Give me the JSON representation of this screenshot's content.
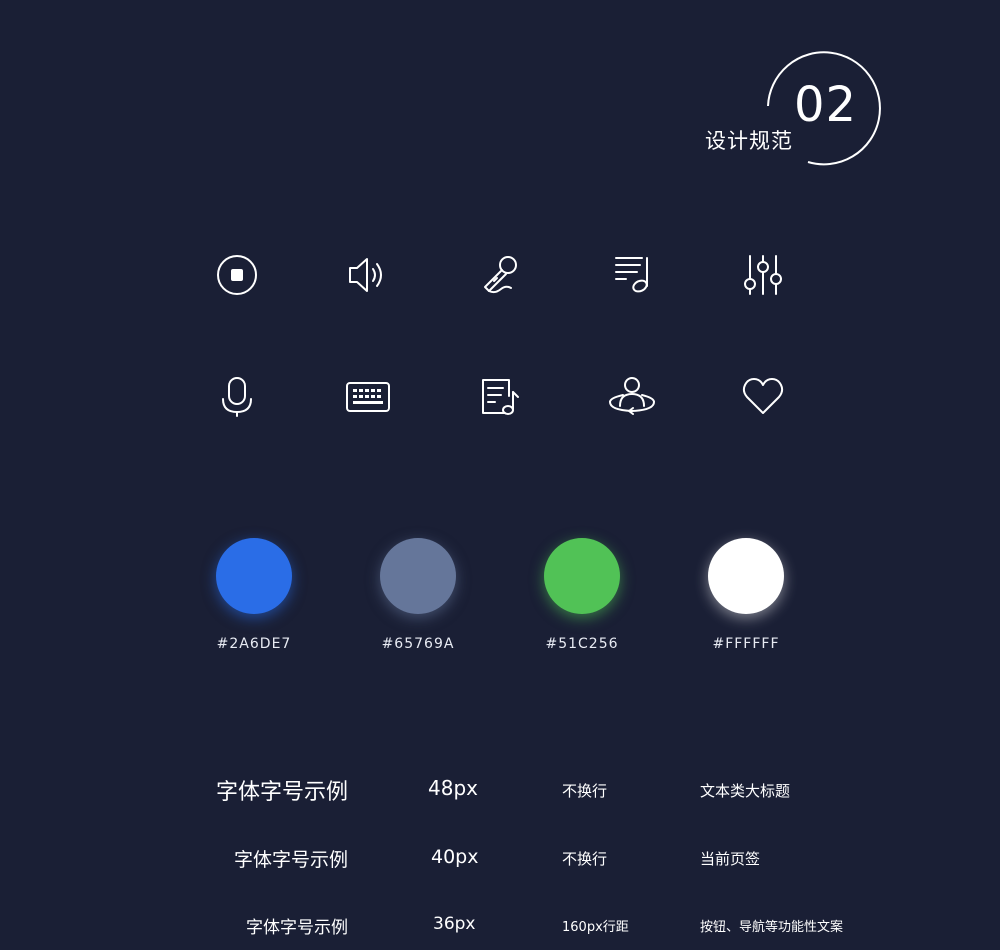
{
  "header": {
    "number": "02",
    "title": "设计规范"
  },
  "icons_row1": [
    "stop-circle-icon",
    "speaker-volume-icon",
    "karaoke-microphone-icon",
    "playlist-music-icon",
    "equalizer-sliders-icon"
  ],
  "icons_row2": [
    "microphone-icon",
    "keyboard-icon",
    "lyrics-document-icon",
    "user-orbit-icon",
    "heart-icon"
  ],
  "colors": [
    {
      "hex": "#2A6DE7",
      "label": "#2A6DE7"
    },
    {
      "hex": "#65769A",
      "label": "#65769A"
    },
    {
      "hex": "#51C256",
      "label": "#51C256"
    },
    {
      "hex": "#FFFFFF",
      "label": "#FFFFFF"
    }
  ],
  "typography": [
    {
      "sample": "字体字号示例",
      "size": "48px",
      "rule": "不换行",
      "usage": "文本类大标题"
    },
    {
      "sample": "字体字号示例",
      "size": "40px",
      "rule": "不换行",
      "usage": "当前页签"
    },
    {
      "sample": "字体字号示例",
      "size": "36px",
      "rule": "160px行距",
      "usage": "按钮、导航等功能性文案"
    }
  ]
}
